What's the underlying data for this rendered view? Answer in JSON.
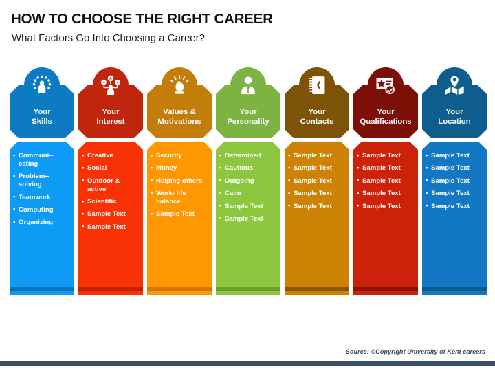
{
  "header": {
    "title": "HOW TO CHOOSE THE RIGHT CAREER",
    "subtitle": "What Factors Go Into Choosing a Career?"
  },
  "footer": {
    "source": "Source: ©Copyright University of Kent careers",
    "bar_color": "#3d4f63"
  },
  "columns": [
    {
      "icon": "person-skills-icon",
      "title_line1": "Your",
      "title_line2": "Skills",
      "header_color": "#0d7ac4",
      "body_color": "#0d9bf5",
      "stripe_color": "#0a72b5",
      "items": [
        "Communi-­ cating",
        "Problem-­ solving",
        "Teamwork",
        "Computing",
        "Organizing"
      ]
    },
    {
      "icon": "network-interest-icon",
      "title_line1": "Your",
      "title_line2": "Interest",
      "header_color": "#c0260b",
      "body_color": "#f93206",
      "stripe_color": "#c32106",
      "items": [
        "Creative",
        "Social",
        "Outdoor & active",
        "Scientific",
        "Sample Text",
        "Sample Text"
      ]
    },
    {
      "icon": "raised-fist-icon",
      "title_line1": "Values &",
      "title_line2": "Motivations",
      "header_color": "#c27d0a",
      "body_color": "#ff9800",
      "stripe_color": "#cb7a05",
      "items": [
        "Security",
        "Money",
        "Helping others",
        "Work- life balance",
        "Sample Text"
      ]
    },
    {
      "icon": "business-person-icon",
      "title_line1": "Your",
      "title_line2": "Personality",
      "header_color": "#7cb342",
      "body_color": "#8dc63f",
      "stripe_color": "#6f9c33",
      "items": [
        "Determined",
        "Cautious",
        "Outgoing",
        "Calm",
        "Sample Text",
        "Sample Text"
      ]
    },
    {
      "icon": "address-book-icon",
      "title_line1": "Your",
      "title_line2": "Contacts",
      "header_color": "#7d5407",
      "body_color": "#cd8105",
      "stripe_color": "#8c5604",
      "items": [
        "Sample Text",
        "Sample Text",
        "Sample Text",
        "Sample Text",
        "Sample Text"
      ]
    },
    {
      "icon": "certificate-check-icon",
      "title_line1": "Your",
      "title_line2": "Qualifications",
      "header_color": "#7d1006",
      "body_color": "#cc2209",
      "stripe_color": "#8b1305",
      "items": [
        "Sample Text",
        "Sample Text",
        "Sample Text",
        "Sample Text",
        "Sample Text"
      ]
    },
    {
      "icon": "map-pin-icon",
      "title_line1": "Your",
      "title_line2": "Location",
      "header_color": "#0e5d8c",
      "body_color": "#1378c4",
      "stripe_color": "#0d5b8c",
      "items": [
        "Sample Text",
        "Sample Text",
        "Sample Text",
        "Sample Text",
        "Sample Text"
      ]
    }
  ]
}
